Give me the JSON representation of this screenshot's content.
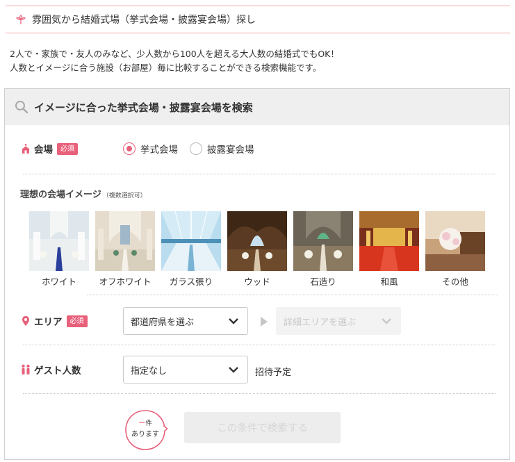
{
  "header": {
    "title": "雰囲気から結婚式場（挙式会場・披露宴会場）探し"
  },
  "intro": {
    "line1": "2人で・家族で・友人のみなど、少人数から100人を超える大人数の結婚式でもOK！",
    "line2": "人数とイメージに合う施設（お部屋）毎に比較することができる検索機能です。"
  },
  "panel": {
    "title": "イメージに合った挙式会場・披露宴会場を検索",
    "venue_row": {
      "label": "会場",
      "required": "必須",
      "options": [
        {
          "label": "挙式会場",
          "checked": true
        },
        {
          "label": "披露宴会場",
          "checked": false
        }
      ]
    },
    "image_row": {
      "label": "理想の会場イメージ",
      "note": "（複数選択可）",
      "items": [
        {
          "label": "ホワイト"
        },
        {
          "label": "オフホワイト"
        },
        {
          "label": "ガラス張り"
        },
        {
          "label": "ウッド"
        },
        {
          "label": "石造り"
        },
        {
          "label": "和風"
        },
        {
          "label": "その他"
        }
      ]
    },
    "area_row": {
      "label": "エリア",
      "required": "必須",
      "prefecture_select": "都道府県を選ぶ",
      "detail_select": "詳細エリアを選ぶ"
    },
    "guest_row": {
      "label": "ゲスト人数",
      "select": "指定なし",
      "suffix": "招待予定"
    },
    "result": {
      "count": "－",
      "unit": "件",
      "text": "あります"
    },
    "search_button": "この条件で検索する"
  },
  "colors": {
    "accent": "#e8607a",
    "header_border": "#f2a7a0",
    "panel_head_bg": "#efefef"
  }
}
